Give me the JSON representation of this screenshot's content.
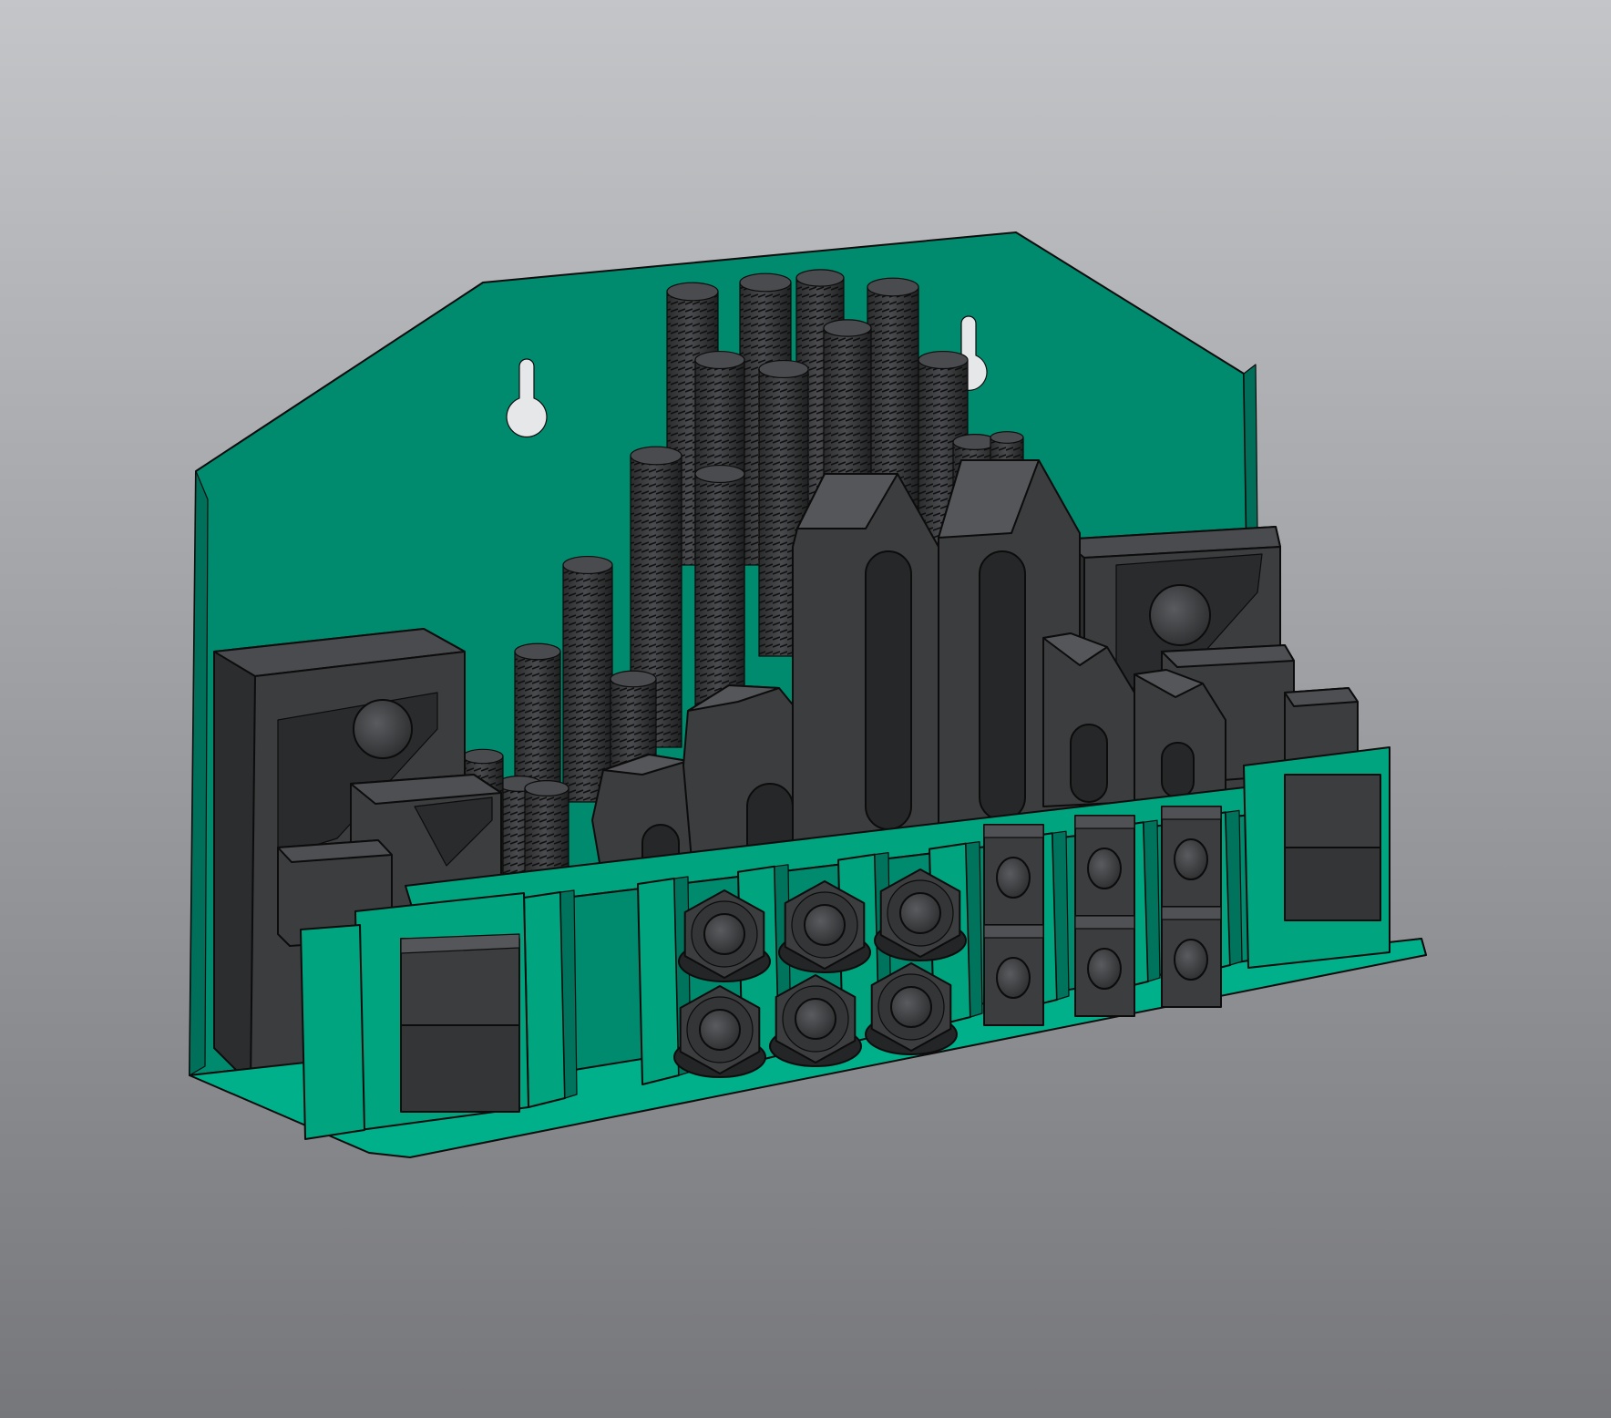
{
  "viewport": {
    "background_top": "#c3c5c8",
    "background_bottom": "#76777b"
  },
  "model": {
    "rack_color": "#008a6e",
    "rack_light_color": "#00a47f",
    "part_color": "#3c3d3f",
    "part_dark_color": "#242526",
    "edge_color": "#0c0c0c"
  }
}
